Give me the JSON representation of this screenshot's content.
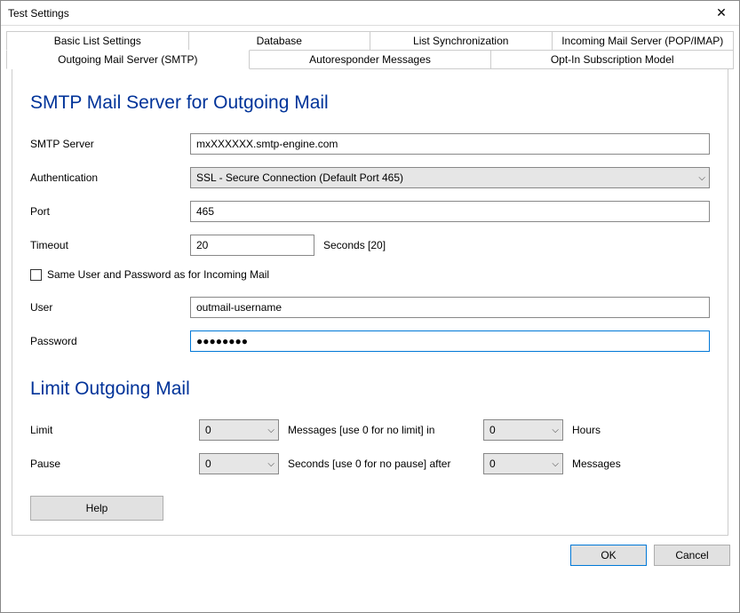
{
  "window": {
    "title": "Test Settings"
  },
  "tabs": {
    "top": [
      "Basic List Settings",
      "Database",
      "List Synchronization",
      "Incoming Mail Server (POP/IMAP)"
    ],
    "bottom": [
      "Outgoing Mail Server (SMTP)",
      "Autoresponder Messages",
      "Opt-In Subscription Model"
    ],
    "active": "Outgoing Mail Server (SMTP)"
  },
  "smtp": {
    "heading": "SMTP Mail Server for Outgoing Mail",
    "server_label": "SMTP Server",
    "server_value": "mxXXXXXX.smtp-engine.com",
    "auth_label": "Authentication",
    "auth_value": "SSL - Secure Connection (Default Port 465)",
    "port_label": "Port",
    "port_value": "465",
    "timeout_label": "Timeout",
    "timeout_value": "20",
    "timeout_suffix": "Seconds [20]",
    "same_user_label": "Same User and Password as for Incoming Mail",
    "user_label": "User",
    "user_value": "outmail-username",
    "password_label": "Password",
    "password_value": "●●●●●●●●"
  },
  "limit": {
    "heading": "Limit Outgoing Mail",
    "limit_label": "Limit",
    "limit_messages_value": "0",
    "limit_messages_text": "Messages [use 0 for no limit] in",
    "limit_hours_value": "0",
    "limit_hours_text": "Hours",
    "pause_label": "Pause",
    "pause_seconds_value": "0",
    "pause_seconds_text": "Seconds [use 0 for no pause] after",
    "pause_messages_value": "0",
    "pause_messages_text": "Messages"
  },
  "buttons": {
    "help": "Help",
    "ok": "OK",
    "cancel": "Cancel"
  }
}
